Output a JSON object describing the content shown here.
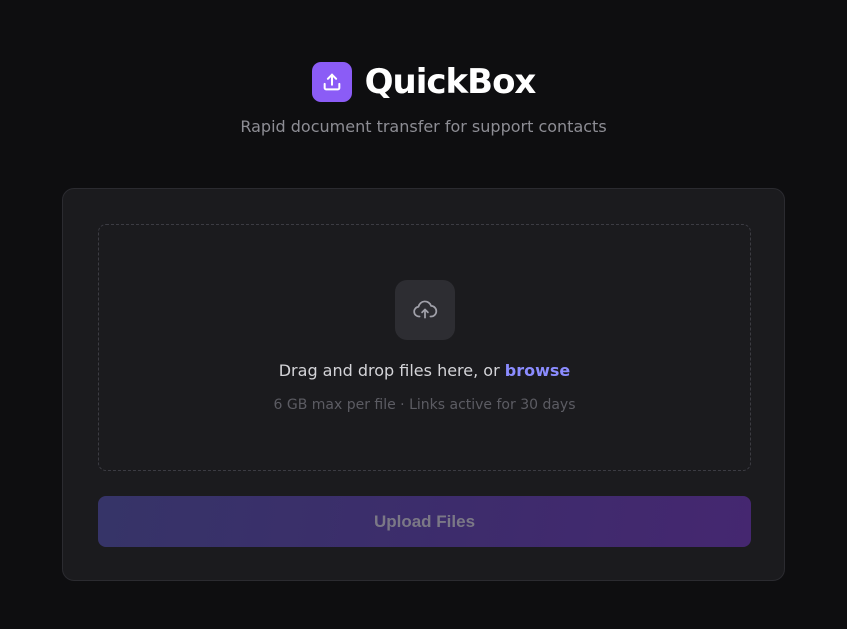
{
  "header": {
    "app_name": "QuickBox",
    "tagline": "Rapid document transfer for support contacts",
    "logo_icon": "upload-icon",
    "logo_color": "#8b5cf6"
  },
  "dropzone": {
    "icon": "cloud-upload-icon",
    "prompt": "Drag and drop files here, or ",
    "browse_label": "browse",
    "limits": "6 GB max per file · Links active for 30 days",
    "link_color": "#8b8cff"
  },
  "actions": {
    "upload_label": "Upload Files"
  }
}
